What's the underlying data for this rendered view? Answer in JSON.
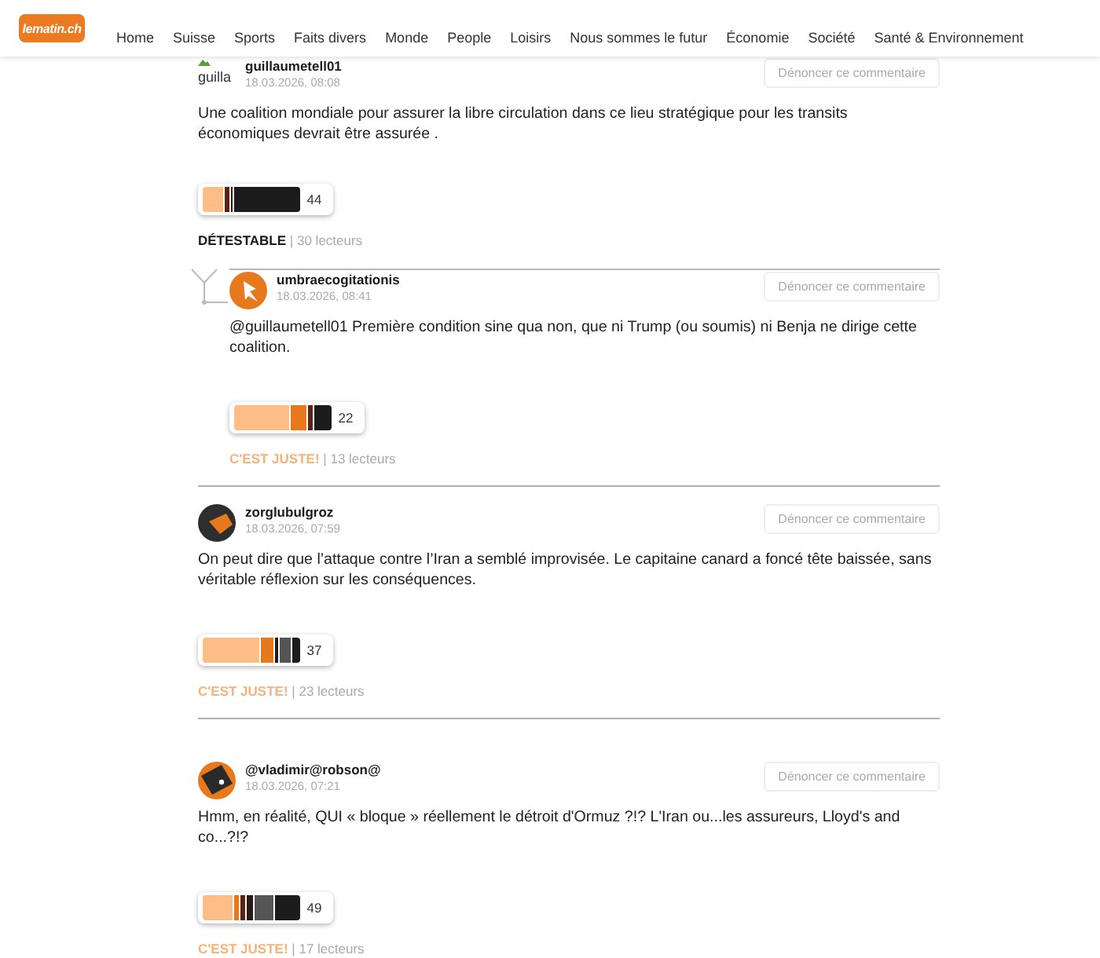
{
  "header": {
    "logo": "lematin.ch",
    "nav": [
      "Home",
      "Suisse",
      "Sports",
      "Faits divers",
      "Monde",
      "People",
      "Loisirs",
      "Nous sommes le futur",
      "Économie",
      "Société",
      "Santé & Environnement"
    ]
  },
  "comments": [
    {
      "avatar": {
        "kind": "broken",
        "alt": "guilla"
      },
      "author": "guillaumetell01",
      "date": "18.03.2026, 08:08",
      "report": "Dénoncer ce commentaire",
      "text": "Une coalition mondiale pour assurer la libre circulation dans ce lieu stratégique pour les transits économiques devrait être assurée .",
      "rating": {
        "count": "44"
      },
      "verdict": {
        "label": "DÉTESTABLE",
        "color": "#1a1a1a"
      },
      "readers": "| 30 lecteurs",
      "replies": [
        {
          "avatar": {
            "kind": "notch"
          },
          "author": "umbraecogitationis",
          "date": "18.03.2026, 08:41",
          "report": "Dénoncer ce commentaire",
          "text": "@guillaumetell01 Première condition sine qua non, que ni Trump (ou soumis) ni Benja ne dirige cette coalition.",
          "rating": {
            "count": "22"
          },
          "verdict": {
            "label": "C'EST JUSTE!",
            "color": "#f5b27a"
          },
          "readers": "| 13 lecteurs"
        }
      ]
    },
    {
      "avatar": {
        "kind": "wedge"
      },
      "author": "zorglubulgroz",
      "date": "18.03.2026, 07:59",
      "report": "Dénoncer ce commentaire",
      "text": "On peut dire que l’attaque contre l’Iran a semblé improvisée. Le capitaine canard a foncé tête baissée, sans véritable réflexion sur les conséquences.",
      "rating": {
        "count": "37"
      },
      "verdict": {
        "label": "C'EST JUSTE!",
        "color": "#f5b27a"
      },
      "readers": "| 23 lecteurs"
    },
    {
      "avatar": {
        "kind": "split"
      },
      "author": "@vladimir@robson@",
      "date": "18.03.2026, 07:21",
      "report": "Dénoncer ce commentaire",
      "text": "Hmm, en réalité, QUI « bloque » réellement le détroit d'Ormuz ?!? L'Iran ou...les assureurs, Lloyd's and co...?!?",
      "rating": {
        "count": "49"
      },
      "verdict": {
        "label": "C'EST JUSTE!",
        "color": "#f5b27a"
      },
      "readers": "| 17 lecteurs"
    }
  ]
}
